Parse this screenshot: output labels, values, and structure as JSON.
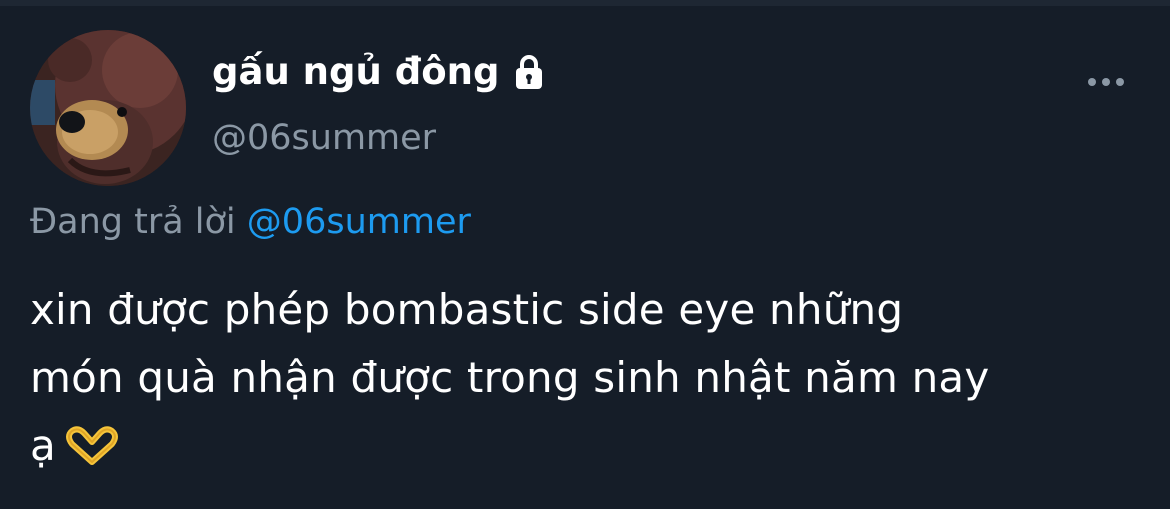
{
  "tweet": {
    "display_name": "gấu ngủ đông",
    "handle": "@06summer",
    "reply_prefix": "Đang trả lời",
    "reply_to": "@06summer",
    "text_line1": "xin được phép bombastic side eye những",
    "text_line2": "món quà nhận được trong sinh nhật năm nay",
    "text_line3": "ạ"
  },
  "icons": {
    "lock": "lock-icon",
    "more": "more-horizontal-icon",
    "emoji": "heart-hands-emoji"
  },
  "colors": {
    "background": "#151d28",
    "secondary_text": "#8b98a5",
    "link": "#1d9bf0",
    "emoji": "#f5c43a"
  }
}
